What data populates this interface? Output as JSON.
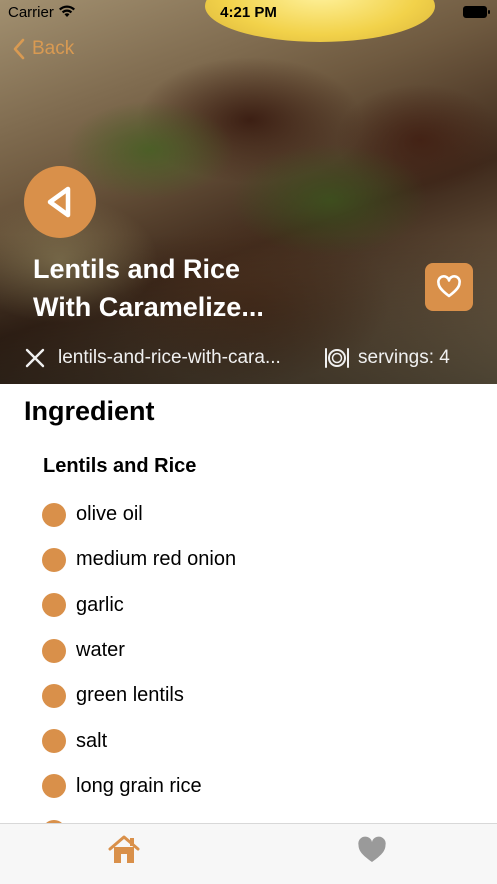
{
  "status_bar": {
    "carrier": "Carrier",
    "time": "4:21 PM"
  },
  "nav": {
    "back_label": "Back"
  },
  "recipe": {
    "title": "Lentils and Rice\nWith Caramelize...",
    "slug": "lentils-and-rice-with-cara...",
    "servings": "servings: 4"
  },
  "ingredients": {
    "heading": "Ingredient",
    "group": "Lentils and Rice",
    "items": [
      "olive oil",
      "medium red onion",
      "garlic",
      "water",
      "green lentils",
      "salt",
      "long grain rice"
    ]
  },
  "tabbar": {
    "items": [
      {
        "icon": "home-icon",
        "active": true
      },
      {
        "icon": "heart-icon",
        "active": false
      }
    ]
  },
  "colors": {
    "accent": "#d9904a",
    "inactive": "#9a9a9a"
  }
}
